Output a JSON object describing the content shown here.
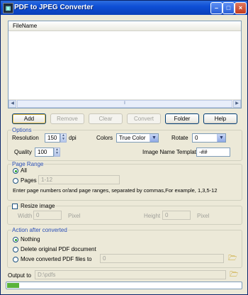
{
  "window": {
    "title": "PDF to JPEG Converter",
    "icon": "app-pdf-icon",
    "controls": [
      "minimize",
      "maximize",
      "close"
    ]
  },
  "file_list": {
    "column_header": "FileName",
    "rows": []
  },
  "buttons": {
    "add": "Add",
    "remove": "Remove",
    "clear": "Clear",
    "convert": "Convert",
    "folder": "Folder",
    "help": "Help"
  },
  "options": {
    "legend": "Options",
    "resolution_label": "Resolution",
    "resolution_value": "150",
    "resolution_unit": "dpi",
    "colors_label": "Colors",
    "colors_value": "True Color",
    "rotate_label": "Rotate",
    "rotate_value": "0",
    "quality_label": "Quality",
    "quality_value": "100",
    "template_label": "Image Name Template",
    "template_value": "-##"
  },
  "page_range": {
    "legend": "Page Range",
    "all_label": "All",
    "all_selected": true,
    "pages_label": "Pages",
    "pages_placeholder": "1-12",
    "hint": "Enter page numbers or/and page ranges, separated by commas,For example, 1,3,5-12"
  },
  "resize": {
    "label": "Resize image",
    "checked": false,
    "width_label": "Width",
    "width_value": "0",
    "width_unit": "Pixel",
    "height_label": "Height",
    "height_value": "0",
    "height_unit": "Pixel"
  },
  "after_convert": {
    "legend": "Action after converted",
    "nothing_label": "Nothing",
    "delete_label": "Delete original PDF document",
    "move_label": "Move converted PDF files to",
    "move_value": "0",
    "selected": "nothing"
  },
  "output": {
    "label": "Output to",
    "value": "D:\\pdfs"
  },
  "progress": {
    "value": 0.05
  }
}
